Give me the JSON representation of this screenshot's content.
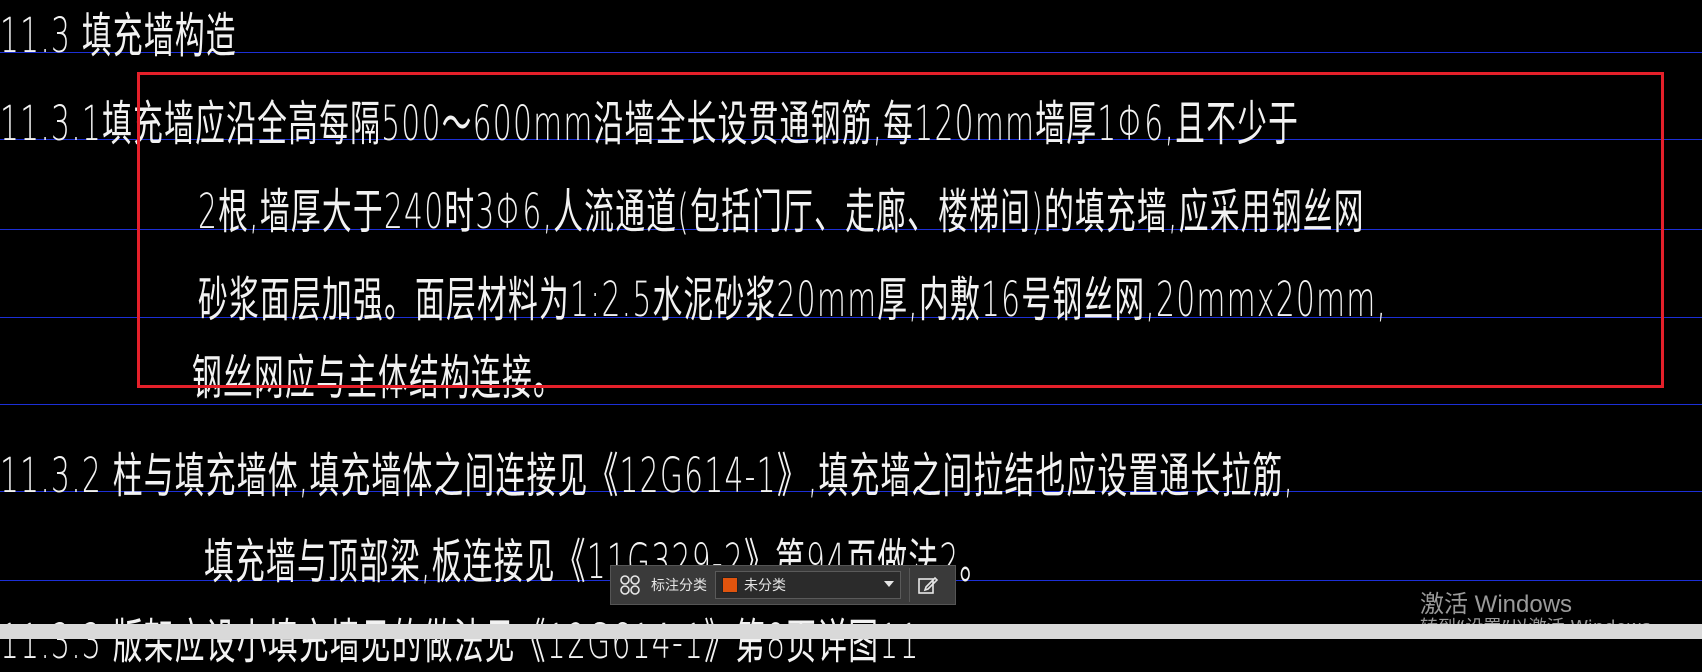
{
  "document": {
    "lines": [
      {
        "id": "l1",
        "text": "11.3  填充墙构造"
      },
      {
        "id": "l2",
        "text": "11.3.1填充墙应沿全高每隔500～600mm沿墙全长设贯通钢筋,每120mm墙厚1Φ6,且不少于"
      },
      {
        "id": "l3",
        "text": "2根,墙厚大于240时3Φ6,人流通道(包括门厅、走廊、楼梯间)的填充墙,应采用钢丝网"
      },
      {
        "id": "l4",
        "text": "砂浆面层加强。面层材料为1:2.5水泥砂浆20mm厚,内敷16号钢丝网,20mmx20mm,"
      },
      {
        "id": "l5",
        "text": "钢丝网应与主体结构连接。"
      },
      {
        "id": "l6",
        "text": "11.3.2  柱与填充墙体,填充墙体之间连接见《12G614-1》,填充墙之间拉结也应设置通长拉筋,"
      },
      {
        "id": "l7",
        "text": "填充墙与顶部梁,板连接见《11G329-2》第94页做法2。"
      },
      {
        "id": "l8",
        "text": "11.3.3  版架应设小填充墙见的做法见《12G614-1》第8页详图11"
      }
    ]
  },
  "annotation_toolbar": {
    "category_label": "标注分类",
    "selected_category": "未分类",
    "selected_color": "#e0540e",
    "group_icon": "grid-icon",
    "edit_icon": "edit-icon"
  },
  "watermark": {
    "line1": "激活 Windows",
    "line2": "转到“设置”以激活 Windows。"
  },
  "colors": {
    "background": "#000000",
    "text": "#f2f2f2",
    "rule": "#1c2fd6",
    "highlight": "#e5202a"
  }
}
